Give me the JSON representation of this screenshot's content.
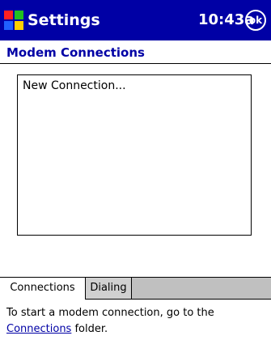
{
  "titlebar": {
    "start_icon": "windows-flag-icon",
    "title": "Settings",
    "time": "10:43a",
    "ok_label": "ok"
  },
  "page": {
    "title": "Modem Connections"
  },
  "connections_list": {
    "items": [
      "New Connection..."
    ]
  },
  "tabs": [
    {
      "label": "Connections",
      "selected": true
    },
    {
      "label": "Dialing",
      "selected": false
    }
  ],
  "help": {
    "prefix": "To start a modem connection, go to the",
    "link": "Connections",
    "suffix": " folder."
  },
  "colors": {
    "titlebar": "#0000a5",
    "accent": "#0000a5",
    "tab_strip": "#c0c0c0"
  }
}
